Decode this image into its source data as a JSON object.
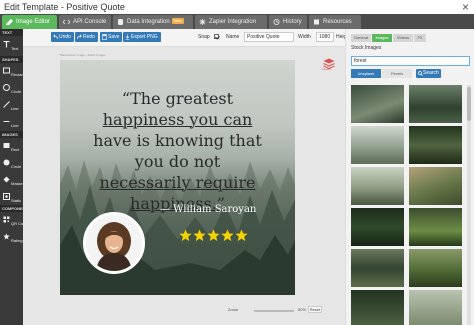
{
  "window": {
    "title": "Edit Template - Positive Quote"
  },
  "tabs": [
    {
      "label": "Image Editor",
      "icon": "pencil-icon",
      "active": true
    },
    {
      "label": "API Console",
      "icon": "code-icon"
    },
    {
      "label": "Data Integration",
      "icon": "database-icon",
      "badge": "beta"
    },
    {
      "label": "Zapier Integration",
      "icon": "zapier-icon"
    },
    {
      "label": "History",
      "icon": "history-icon"
    },
    {
      "label": "Resources",
      "icon": "book-icon"
    }
  ],
  "sidebar": {
    "sections": [
      {
        "title": "TEXT",
        "items": [
          {
            "label": "Text",
            "icon": "text-icon"
          }
        ]
      },
      {
        "title": "SHAPES",
        "items": [
          {
            "label": "Rectangle",
            "icon": "rectangle-icon"
          },
          {
            "label": "Circle",
            "icon": "circle-icon"
          },
          {
            "label": "Line",
            "icon": "line-icon"
          },
          {
            "label": "Line",
            "icon": "line-icon"
          }
        ]
      },
      {
        "title": "IMAGES",
        "items": [
          {
            "label": "Rect",
            "icon": "image-rect-icon"
          },
          {
            "label": "Circle",
            "icon": "image-circle-icon"
          },
          {
            "label": "Masked",
            "icon": "masked-icon"
          },
          {
            "label": "Static",
            "icon": "static-icon"
          }
        ]
      },
      {
        "title": "COMPONENTS",
        "items": [
          {
            "label": "QR Code",
            "icon": "qr-code-icon"
          },
          {
            "label": "Rating",
            "icon": "rating-icon"
          }
        ]
      }
    ]
  },
  "toolbar": {
    "undo": "Undo",
    "redo": "Redo",
    "save": "Save",
    "export": "Export PNG",
    "snap_label": "Snap",
    "snap_checked": true,
    "name_label": "Name",
    "name_value": "Positive Quote",
    "width_label": "Width",
    "width_value": "1080",
    "height_label": "Height",
    "height_value": "1080"
  },
  "canvas": {
    "breadcrumb": "Bannerbear Image • Stock images",
    "quote_lines": [
      "“The greatest",
      "happiness you can",
      "have is knowing that",
      "you do not",
      "necessarily require",
      "happiness.”"
    ],
    "attribution": "— William Saroyan",
    "rating_stars": 5,
    "layers_label": "Layers"
  },
  "zoom": {
    "label": "Zoom",
    "value": "50%",
    "reset": "Reset"
  },
  "right_panel": {
    "tabs": [
      {
        "label": "General"
      },
      {
        "label": "Images",
        "active": true
      },
      {
        "label": "Videos"
      },
      {
        "label": "FX"
      }
    ],
    "heading": "Stock Images",
    "search_value": "forest",
    "sources": [
      {
        "label": "Unsplash",
        "active": true
      },
      {
        "label": "Pexels"
      }
    ],
    "search_button": "Search"
  },
  "colors": {
    "accent_green": "#5cb85c",
    "primary_blue": "#337ab7",
    "sidebar_dark": "#3a3a3a",
    "star_yellow": "#f5d300"
  }
}
